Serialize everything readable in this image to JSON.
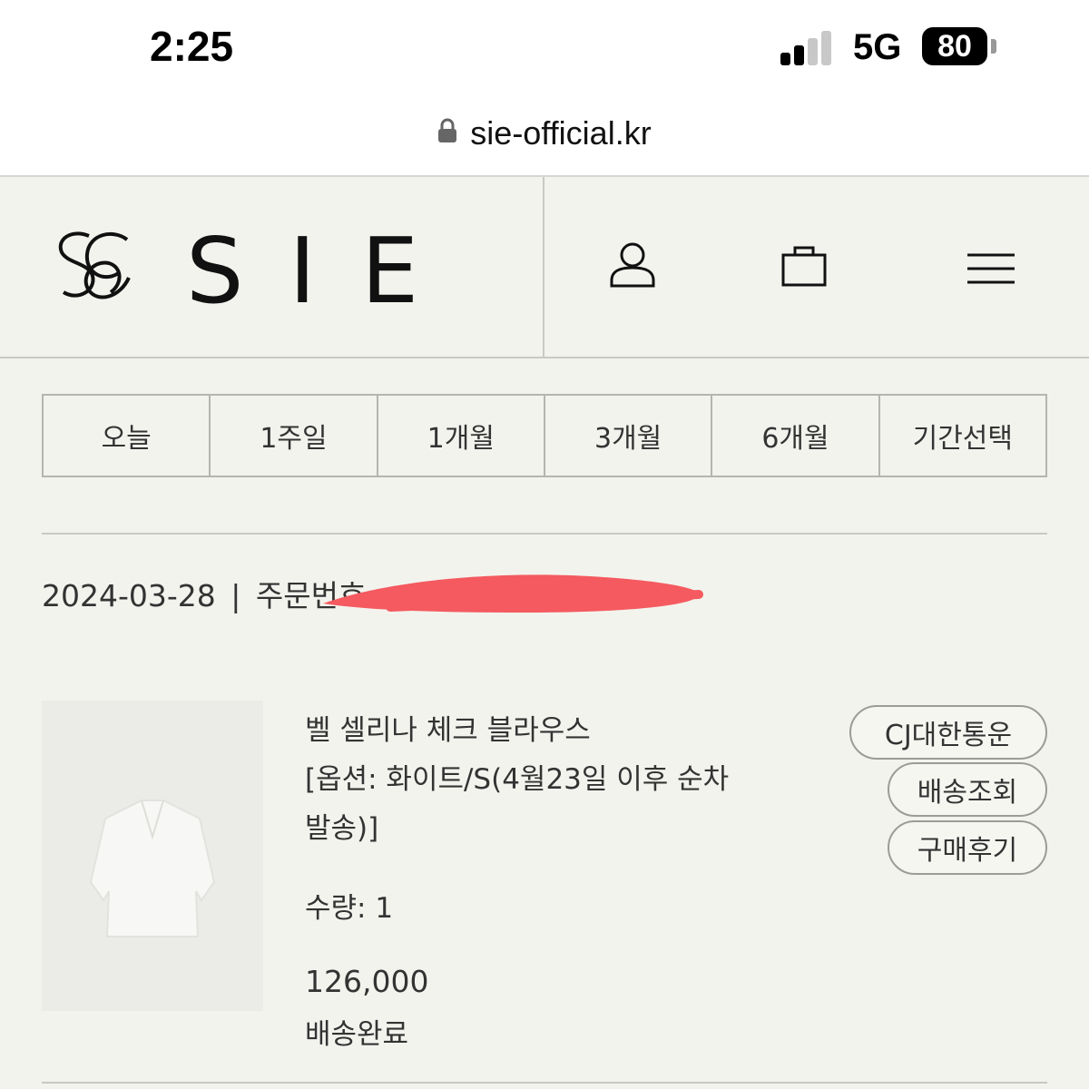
{
  "status_bar": {
    "time": "2:25",
    "network": "5G",
    "battery": "80"
  },
  "browser": {
    "url": "sie-official.kr"
  },
  "header": {
    "logo_text": "SIE"
  },
  "period_tabs": [
    "오늘",
    "1주일",
    "1개월",
    "3개월",
    "6개월",
    "기간선택"
  ],
  "order": {
    "date": "2024-03-28",
    "separator": "|",
    "number_label": "주문번호:"
  },
  "product": {
    "name": "벨 셀리나 체크 블라우스",
    "option_line1": "[옵션: 화이트/S(4월23일 이후 순차",
    "option_line2": "발송)]",
    "quantity": "수량: 1",
    "price": "126,000",
    "status": "배송완료"
  },
  "actions": {
    "courier": "CJ대한통운",
    "tracking": "배송조회",
    "review": "구매후기"
  },
  "colors": {
    "background": "#f3f3ee",
    "redaction": "#f45a5f",
    "border": "#b5b5b0"
  }
}
